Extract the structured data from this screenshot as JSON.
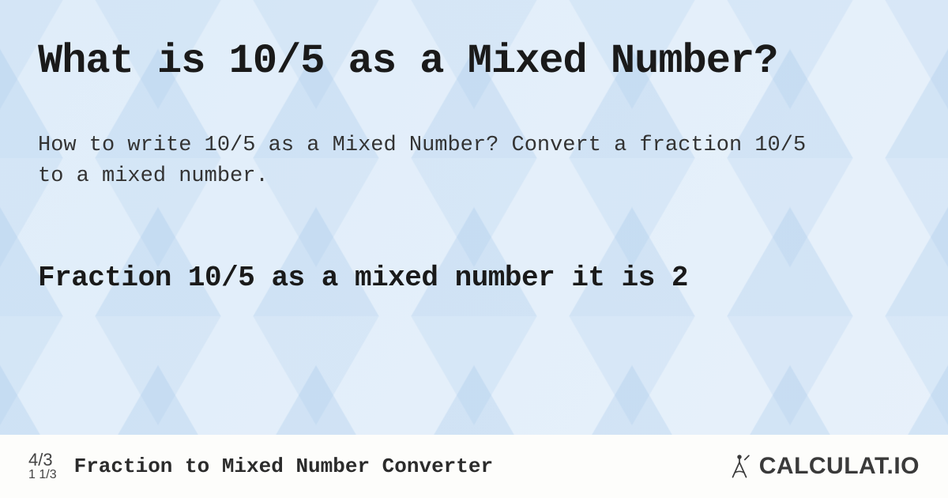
{
  "title": "What is 10/5 as a Mixed Number?",
  "description": "How to write 10/5 as a Mixed Number? Convert a fraction 10/5 to a mixed number.",
  "answer": "Fraction 10/5 as a mixed number it is 2",
  "footer": {
    "icon_top": "4/3",
    "icon_bottom": "1 1/3",
    "tool_name": "Fraction to Mixed Number Converter",
    "brand": "CALCULAT.IO"
  }
}
